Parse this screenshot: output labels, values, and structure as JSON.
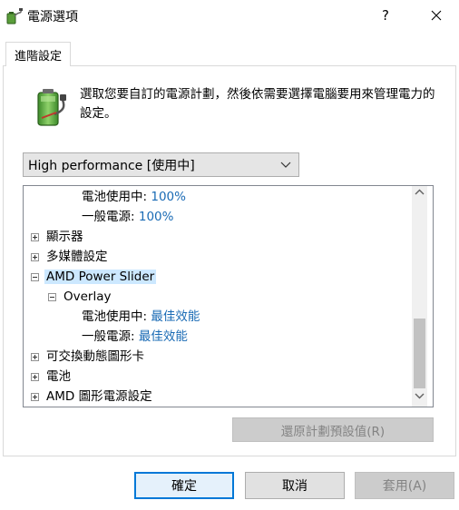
{
  "window": {
    "title": "電源選項",
    "help_label": "?",
    "close_icon": "close-icon"
  },
  "tabs": [
    {
      "label": "進階設定",
      "active": true
    }
  ],
  "description": "選取您要自訂的電源計劃，然後依需要選擇電腦要用來管理電力的設定。",
  "plan_select": {
    "selected": "High performance [使用中]"
  },
  "tree": {
    "items": [
      {
        "label": "電池使用中:",
        "value": "100%"
      },
      {
        "label": "一般電源:",
        "value": "100%"
      },
      {
        "label": "顯示器",
        "expander": "plus"
      },
      {
        "label": "多媒體設定",
        "expander": "plus"
      },
      {
        "label": "AMD Power Slider",
        "expander": "minus",
        "selected": true
      },
      {
        "label": "Overlay",
        "expander": "minus"
      },
      {
        "label": "電池使用中:",
        "value": "最佳效能"
      },
      {
        "label": "一般電源:",
        "value": "最佳效能"
      },
      {
        "label": "可交換動態圖形卡",
        "expander": "plus"
      },
      {
        "label": "電池",
        "expander": "plus"
      },
      {
        "label": "AMD 圖形電源設定",
        "expander": "plus"
      }
    ]
  },
  "restore_defaults_label": "還原計劃預設值(R)",
  "buttons": {
    "ok": "確定",
    "cancel": "取消",
    "apply": "套用(A)"
  },
  "colors": {
    "value_text": "#1a6bb5",
    "selection": "#cce8ff",
    "ok_border": "#0078d7"
  }
}
